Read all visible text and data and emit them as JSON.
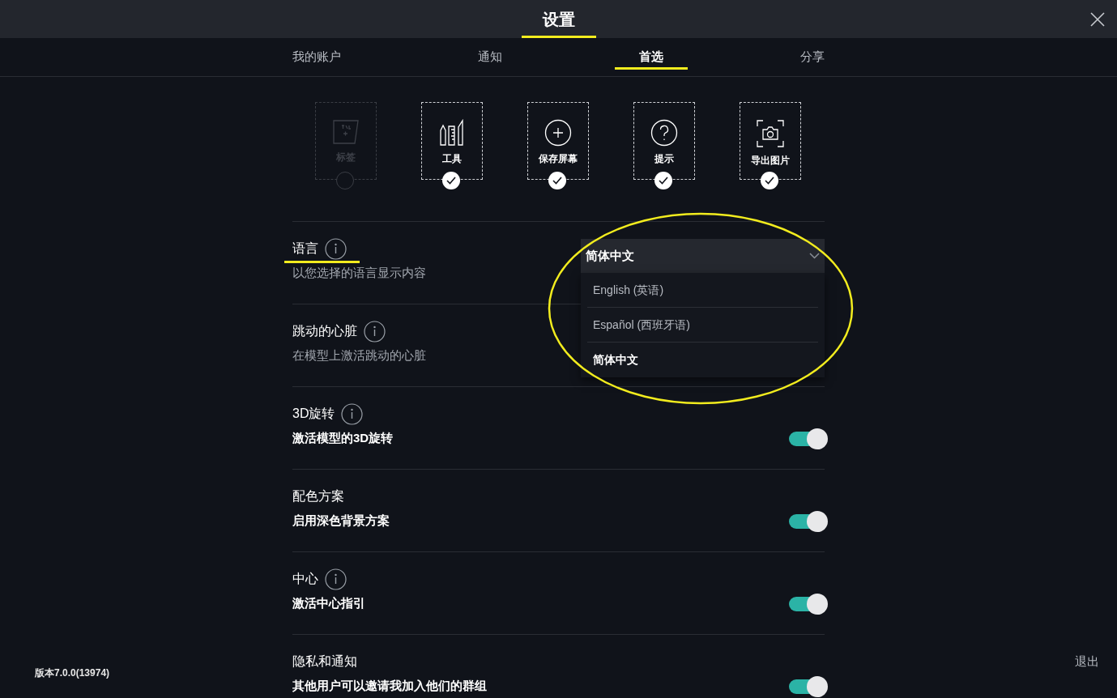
{
  "window": {
    "title": "设置",
    "highlighted": true
  },
  "tabs": [
    {
      "label": "我的账户",
      "selected": false
    },
    {
      "label": "通知",
      "selected": false
    },
    {
      "label": "首选",
      "selected": true
    },
    {
      "label": "分享",
      "selected": false
    }
  ],
  "features": [
    {
      "label": "标签",
      "kind": "tab",
      "checked": false
    },
    {
      "label": "工具",
      "kind": "tools",
      "checked": true
    },
    {
      "label": "保存屏幕",
      "kind": "plus",
      "checked": true
    },
    {
      "label": "提示",
      "kind": "question",
      "checked": true
    },
    {
      "label": "导出图片",
      "kind": "camera",
      "checked": true
    }
  ],
  "settings": [
    {
      "kind": "dropdown",
      "title": "语言",
      "info": true,
      "highlighted": true,
      "description": "以您选择的语言显示内容",
      "value": "简体中文",
      "expanded": true,
      "circled": true,
      "options": [
        {
          "label": "English (英语)",
          "selected": false
        },
        {
          "label": "Español (西班牙语)",
          "selected": false
        },
        {
          "label": "简体中文",
          "selected": true
        }
      ]
    },
    {
      "kind": "plain",
      "title": "跳动的心脏",
      "info": true,
      "highlighted": false,
      "description": "在模型上激活跳动的心脏"
    },
    {
      "kind": "toggle",
      "title": "3D旋转",
      "info": true,
      "highlighted": false,
      "description": "激活模型的3D旋转",
      "on": true
    },
    {
      "kind": "toggle",
      "title": "配色方案",
      "info": false,
      "highlighted": false,
      "description": "启用深色背景方案",
      "on": true
    },
    {
      "kind": "toggle",
      "title": "中心",
      "info": true,
      "highlighted": false,
      "description": "激活中心指引",
      "on": true
    },
    {
      "kind": "toggle",
      "title": "隐私和通知",
      "info": false,
      "highlighted": false,
      "description": "其他用户可以邀请我加入他们的群组",
      "on": true
    }
  ],
  "version": "版本7.0.0(13974)",
  "logout": "退出"
}
